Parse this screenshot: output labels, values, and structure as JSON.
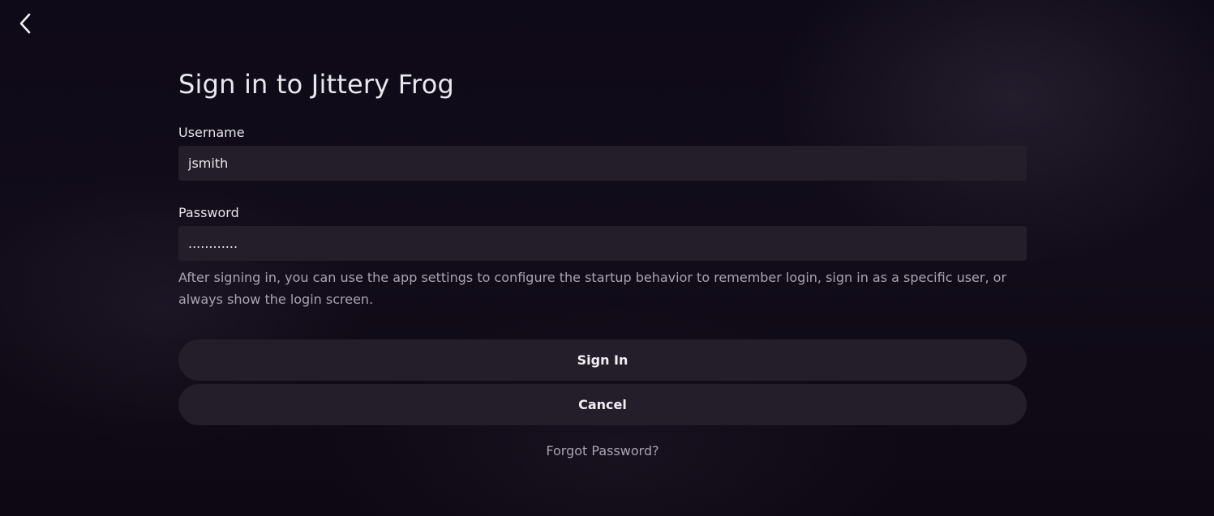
{
  "icons": {
    "back": "chevron-left-icon"
  },
  "colors": {
    "background": "#0d0814",
    "field": "#241e2a",
    "button": "#241e2a",
    "text": "#e9e7ee",
    "muted": "#a9a4b0"
  },
  "login": {
    "title": "Sign in to Jittery Frog",
    "username_label": "Username",
    "username_value": "jsmith",
    "password_label": "Password",
    "password_value": "............",
    "help_text": "After signing in, you can use the app settings to configure the startup behavior to remember login, sign in as a specific user, or always show the login screen.",
    "signin_label": "Sign In",
    "cancel_label": "Cancel",
    "forgot_label": "Forgot Password?"
  }
}
